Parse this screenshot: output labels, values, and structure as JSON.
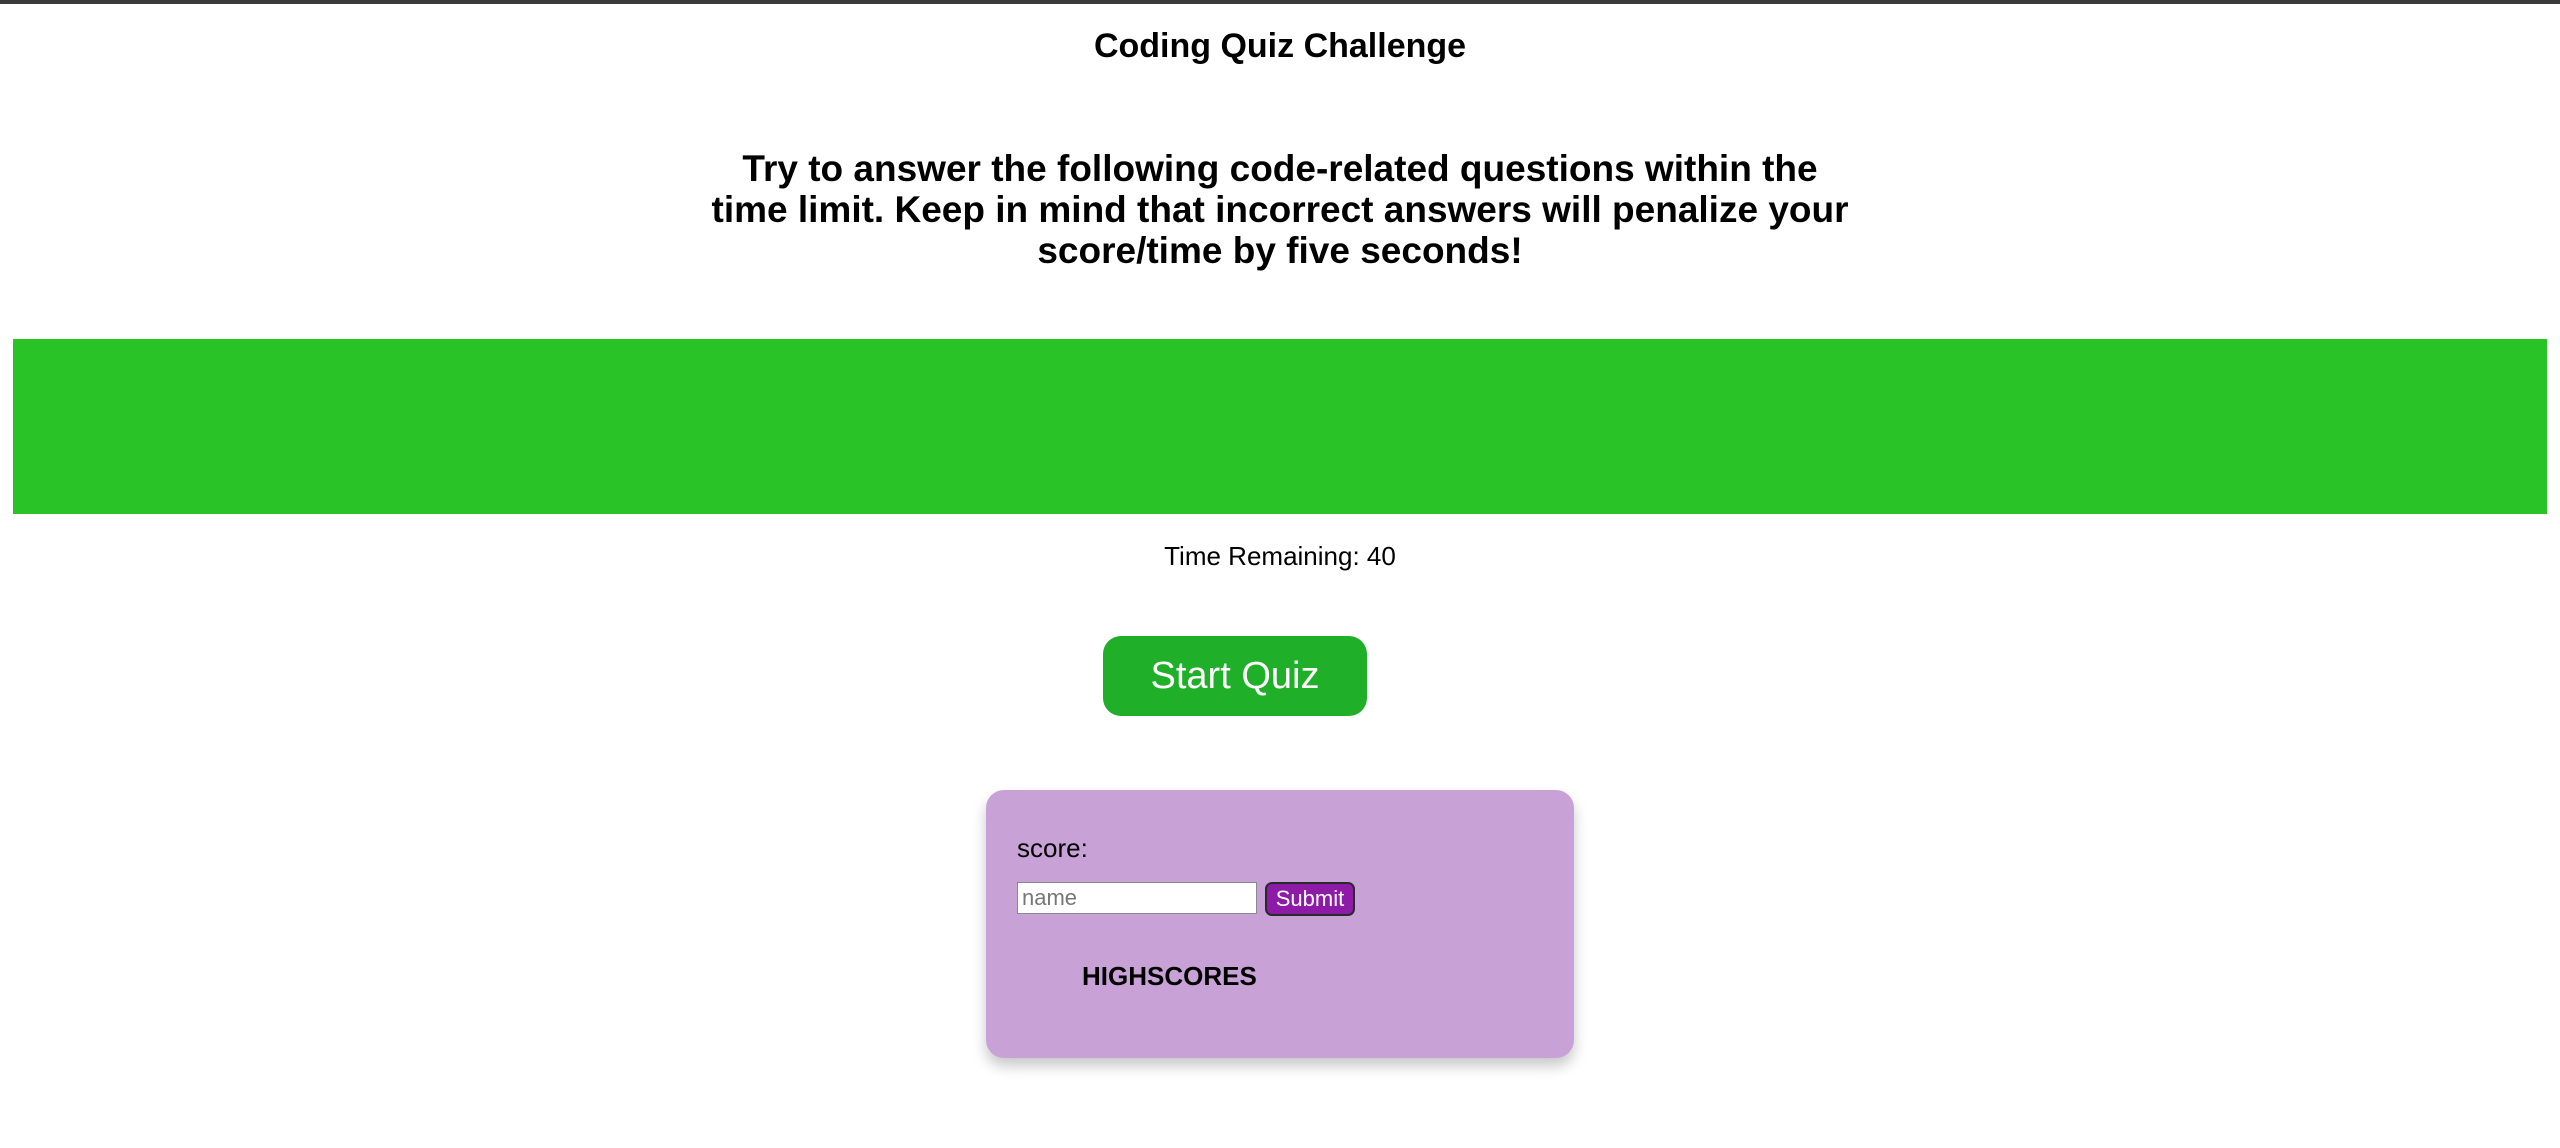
{
  "header": {
    "title": "Coding Quiz Challenge"
  },
  "intro": {
    "text": "Try to answer the following code-related questions within the time limit. Keep in mind that incorrect answers will penalize your score/time by five seconds!"
  },
  "timer": {
    "label": "Time Remaining: 40",
    "progress_fraction": 1.0,
    "bar_color": "#29c227"
  },
  "start": {
    "label": "Start Quiz",
    "color": "#1faf28"
  },
  "score_card": {
    "background": "#c8a1d6",
    "score_label": "score:",
    "name_placeholder": "name",
    "name_value": "",
    "submit_label": "Submit",
    "submit_color": "#8e1aa8",
    "highscores_title": "HIGHSCORES"
  }
}
